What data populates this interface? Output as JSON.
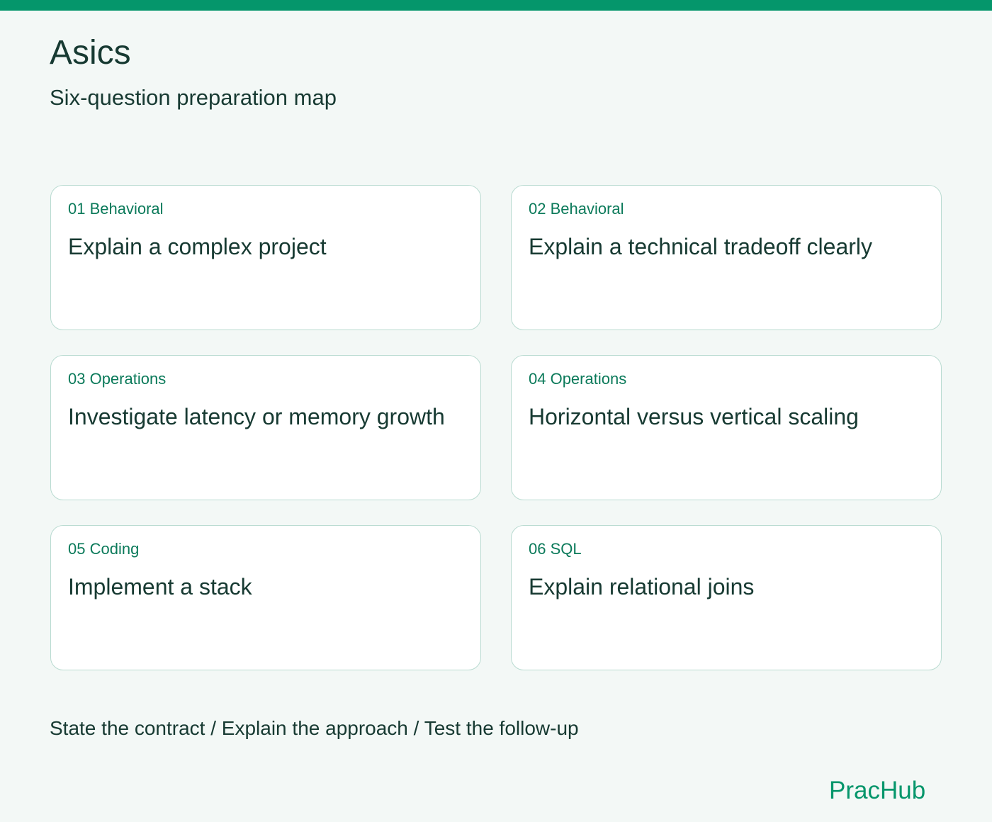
{
  "header": {
    "title": "Asics",
    "subtitle": "Six-question preparation map"
  },
  "cards": [
    {
      "label": "01 Behavioral",
      "text": "Explain a complex project"
    },
    {
      "label": "02 Behavioral",
      "text": "Explain a technical tradeoff clearly"
    },
    {
      "label": "03 Operations",
      "text": "Investigate latency or memory growth"
    },
    {
      "label": "04 Operations",
      "text": "Horizontal versus vertical scaling"
    },
    {
      "label": "05 Coding",
      "text": "Implement a stack"
    },
    {
      "label": "06 SQL",
      "text": "Explain relational joins"
    }
  ],
  "footer": {
    "text": "State the contract / Explain the approach / Test the follow-up"
  },
  "brand": {
    "name": "PracHub"
  },
  "colors": {
    "accent": "#05966b",
    "label": "#0b7a5a",
    "text": "#173a32",
    "background": "#f3f8f6",
    "card_border": "#b9dbd1"
  }
}
